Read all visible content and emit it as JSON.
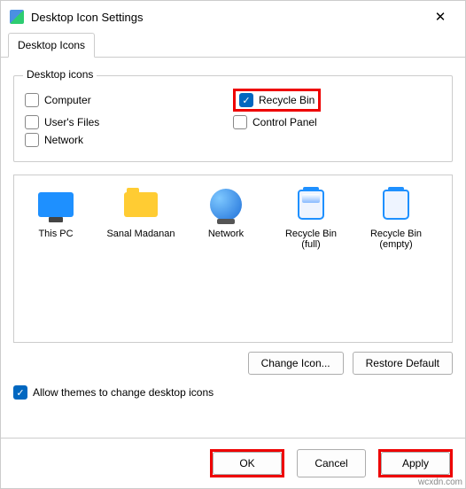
{
  "window": {
    "title": "Desktop Icon Settings"
  },
  "tab": {
    "label": "Desktop Icons"
  },
  "group": {
    "legend": "Desktop icons",
    "items": {
      "computer": {
        "label": "Computer",
        "checked": false
      },
      "recyclebin": {
        "label": "Recycle Bin",
        "checked": true,
        "highlighted": true
      },
      "userfiles": {
        "label": "User's Files",
        "checked": false
      },
      "controlpnl": {
        "label": "Control Panel",
        "checked": false
      },
      "network": {
        "label": "Network",
        "checked": false
      }
    }
  },
  "icons": {
    "thispc": {
      "label": "This PC"
    },
    "user": {
      "label": "Sanal Madanan"
    },
    "network": {
      "label": "Network"
    },
    "binfull": {
      "label": "Recycle Bin (full)"
    },
    "binempty": {
      "label": "Recycle Bin (empty)"
    }
  },
  "buttons": {
    "changeicon": "Change Icon...",
    "restore": "Restore Default",
    "ok": "OK",
    "cancel": "Cancel",
    "apply": "Apply"
  },
  "allow": {
    "label": "Allow themes to change desktop icons",
    "checked": true
  },
  "watermark": "wcxdn.com"
}
